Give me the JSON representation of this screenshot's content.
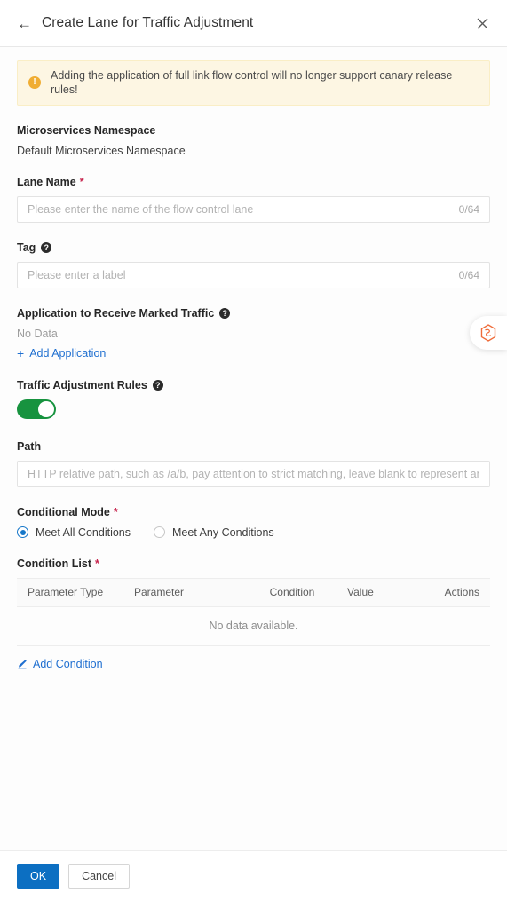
{
  "header": {
    "back_icon": "arrow-left-icon",
    "title": "Create Lane for Traffic Adjustment",
    "close_icon": "close-icon"
  },
  "banner": {
    "icon": "warning-icon",
    "text": "Adding the application of full link flow control will no longer support canary release rules!"
  },
  "namespace": {
    "label": "Microservices Namespace",
    "value": "Default Microservices Namespace"
  },
  "lane_name": {
    "label": "Lane Name",
    "required_mark": "*",
    "placeholder": "Please enter the name of the flow control lane",
    "value": "",
    "counter": "0/64"
  },
  "tag": {
    "label": "Tag",
    "help_icon": "help-icon",
    "placeholder": "Please enter a label",
    "value": "",
    "counter": "0/64"
  },
  "application": {
    "label": "Application to Receive Marked Traffic",
    "help_icon": "help-icon",
    "no_data": "No Data",
    "add_label": "Add Application",
    "add_icon": "plus-icon"
  },
  "traffic_rules": {
    "label": "Traffic Adjustment Rules",
    "help_icon": "help-icon",
    "toggle_on": true,
    "toggle_color": "#17933f"
  },
  "path": {
    "label": "Path",
    "placeholder": "HTTP relative path, such as /a/b, pay attention to strict matching, leave blank to represent any path.",
    "value": ""
  },
  "conditional_mode": {
    "label": "Conditional Mode",
    "required_mark": "*",
    "options": [
      {
        "label": "Meet All Conditions",
        "selected": true
      },
      {
        "label": "Meet Any Conditions",
        "selected": false
      }
    ]
  },
  "condition_list": {
    "label": "Condition List",
    "required_mark": "*",
    "columns": [
      "Parameter Type",
      "Parameter",
      "Condition",
      "Value",
      "Actions"
    ],
    "empty_text": "No data available.",
    "add_label": "Add Condition",
    "add_icon": "edit-pencil-icon"
  },
  "footer": {
    "ok_label": "OK",
    "cancel_label": "Cancel",
    "primary_color": "#0c6fc2"
  },
  "side_widget": {
    "icon": "hexagon-logo-icon",
    "color": "#ef6c3a"
  }
}
